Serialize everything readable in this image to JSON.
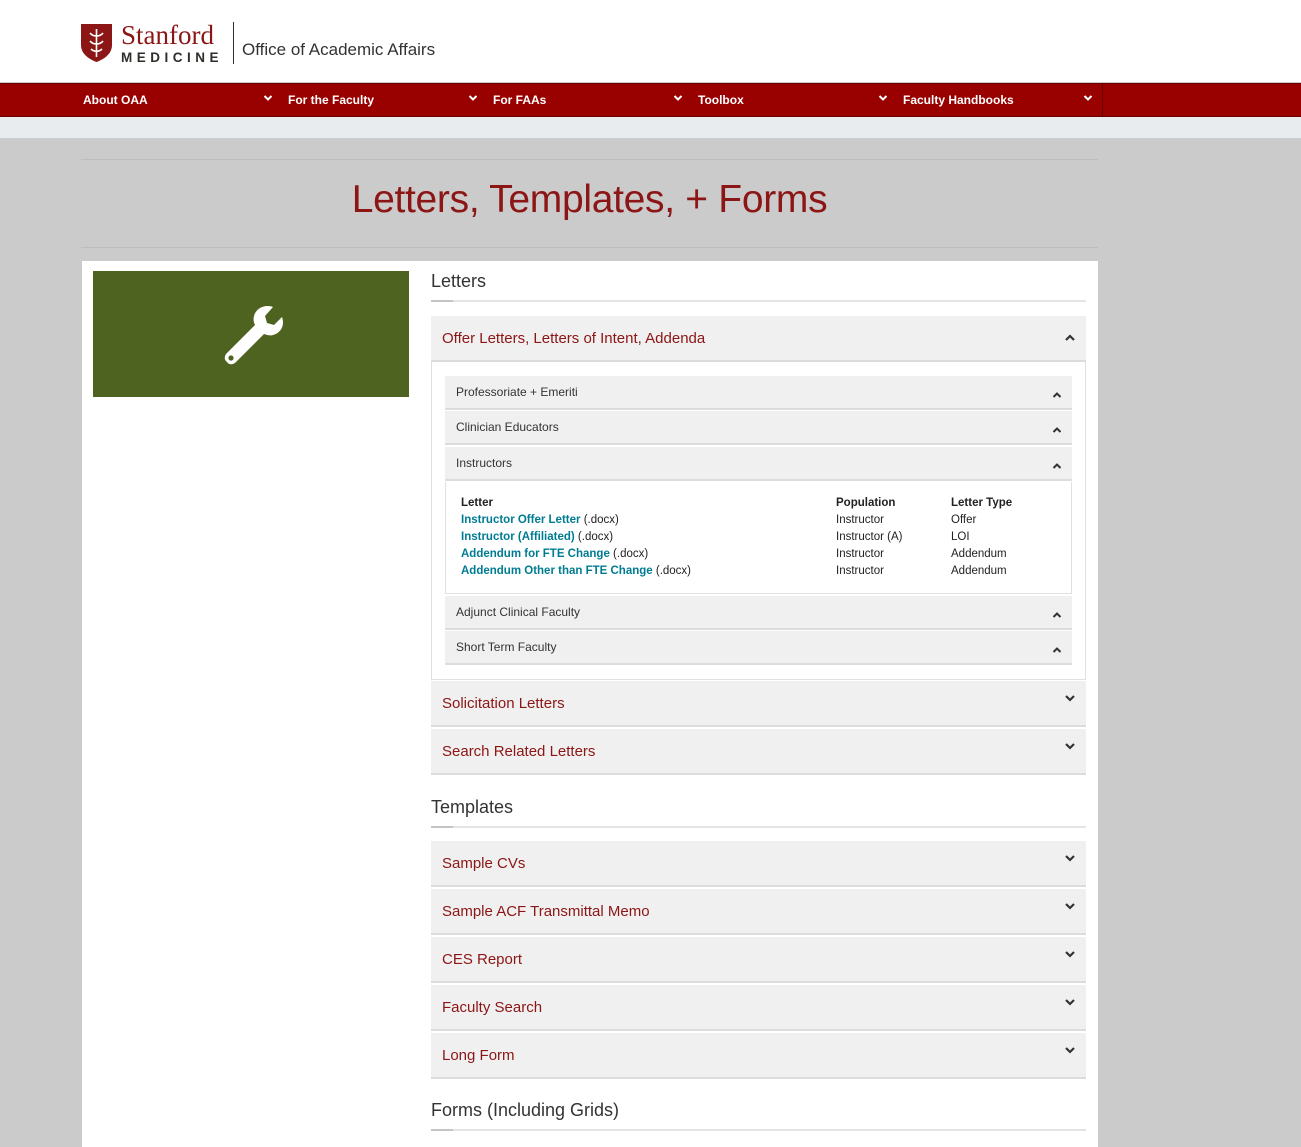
{
  "header": {
    "logo_top": "Stanford",
    "logo_bottom": "MEDICINE",
    "office": "Office of Academic Affairs"
  },
  "nav": {
    "items": [
      "About OAA",
      "For the Faculty",
      "For FAAs",
      "Toolbox",
      "Faculty Handbooks"
    ]
  },
  "page": {
    "title": "Letters, Templates, + Forms"
  },
  "icons": {
    "hero": "wrench-icon",
    "expanded": "chevron-up-icon",
    "collapsed": "chevron-down-icon"
  },
  "colors": {
    "brand": "#8c1515",
    "nav_bg": "#990000",
    "hero_bg": "#4f6320",
    "link": "#007c92"
  },
  "letters": {
    "heading": "Letters",
    "offer": {
      "label": "Offer Letters, Letters of Intent, Addenda",
      "subsections": [
        "Professoriate + Emeriti",
        "Clinician Educators",
        "Instructors",
        "Adjunct Clinical Faculty",
        "Short Term Faculty"
      ],
      "table": {
        "headers": [
          "Letter",
          "Population",
          "Letter Type"
        ],
        "rows": [
          {
            "link": "Instructor Offer Letter",
            "ext": " (.docx)",
            "population": "Instructor",
            "type": "Offer"
          },
          {
            "link": "Instructor (Affiliated)",
            "ext": " (.docx)",
            "population": "Instructor (A)",
            "type": "LOI"
          },
          {
            "link": "Addendum for FTE Change",
            "ext": " (.docx)",
            "population": "Instructor",
            "type": "Addendum"
          },
          {
            "link": "Addendum Other than FTE Change",
            "ext": " (.docx)",
            "population": "Instructor",
            "type": "Addendum"
          }
        ]
      }
    },
    "others": [
      "Solicitation Letters",
      "Search Related Letters"
    ]
  },
  "templates": {
    "heading": "Templates",
    "items": [
      "Sample CVs",
      "Sample ACF Transmittal Memo",
      "CES Report",
      "Faculty Search",
      "Long Form"
    ]
  },
  "forms": {
    "heading": "Forms (Including Grids)"
  }
}
